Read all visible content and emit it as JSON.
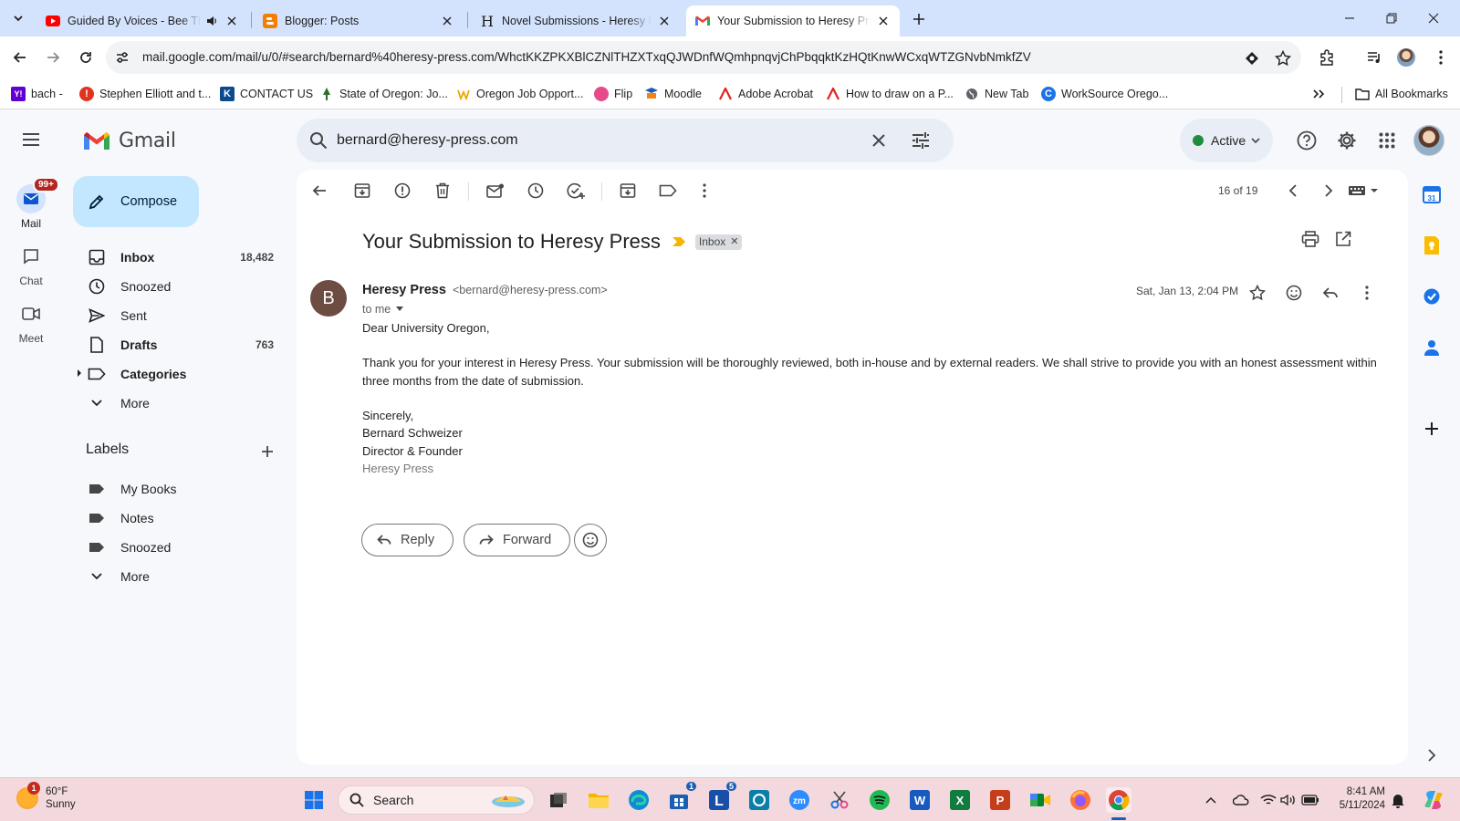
{
  "browser": {
    "tabs": [
      {
        "title": "Guided By Voices - Bee Thousand",
        "favicon": "youtube-icon"
      },
      {
        "title": "Blogger: Posts",
        "favicon": "blogger-icon"
      },
      {
        "title": "Novel Submissions - Heresy Press",
        "favicon": "h-icon"
      },
      {
        "title": "Your Submission to Heresy Press",
        "favicon": "gmail-icon"
      }
    ],
    "url": "mail.google.com/mail/u/0/#search/bernard%40heresy-press.com/WhctKKZPKXBlCZNlTHZXTxqQJWDnfWQmhpnqvjChPbqqktKzHQtKnwWCxqWTZGNvbNmkfZV",
    "bookmarks": [
      {
        "label": "bach -",
        "icon": "Y!",
        "color": "#6001d2"
      },
      {
        "label": "Stephen Elliott and t...",
        "icon": "!",
        "color": "#e0341e"
      },
      {
        "label": "CONTACT US",
        "icon": "K",
        "color": "#0b4a8c"
      },
      {
        "label": "State of Oregon: Jo...",
        "icon": "",
        "color": "#2f6d2a"
      },
      {
        "label": "Oregon Job Opport...",
        "icon": "",
        "color": "#f0a500"
      },
      {
        "label": "Flip",
        "icon": "",
        "color": "#e64a8b"
      },
      {
        "label": "Moodle",
        "icon": "",
        "color": "#1a5bb6"
      },
      {
        "label": "Adobe Acrobat",
        "icon": "",
        "color": "#e0241e"
      },
      {
        "label": "How to draw on a P...",
        "icon": "",
        "color": "#e0241e"
      },
      {
        "label": "New Tab",
        "icon": "",
        "color": "#5f6368"
      },
      {
        "label": "WorkSource Orego...",
        "icon": "C",
        "color": "#1a73e8"
      }
    ],
    "all_bookmarks": "All Bookmarks"
  },
  "gmail": {
    "product_name": "Gmail",
    "search_value": "bernard@heresy-press.com",
    "status": "Active",
    "rail": [
      {
        "label": "Mail",
        "badge": "99+"
      },
      {
        "label": "Chat"
      },
      {
        "label": "Meet"
      }
    ],
    "compose": "Compose",
    "nav": [
      {
        "label": "Inbox",
        "count": "18,482"
      },
      {
        "label": "Snoozed",
        "count": ""
      },
      {
        "label": "Sent",
        "count": ""
      },
      {
        "label": "Drafts",
        "count": "763"
      },
      {
        "label": "Categories",
        "count": ""
      },
      {
        "label": "More",
        "count": ""
      }
    ],
    "labels_heading": "Labels",
    "labels": [
      {
        "label": "My Books"
      },
      {
        "label": "Notes"
      },
      {
        "label": "Snoozed"
      },
      {
        "label": "More"
      }
    ]
  },
  "message": {
    "pager": "16 of 19",
    "subject": "Your Submission to Heresy Press",
    "label_chip": "Inbox",
    "sender_initial": "B",
    "sender_name": "Heresy Press",
    "sender_email": "<bernard@heresy-press.com>",
    "to": "to me",
    "date": "Sat, Jan 13, 2:04 PM",
    "greeting": "Dear University Oregon,",
    "paragraph": "Thank you for your interest in Heresy Press. Your submission will be thoroughly reviewed, both in-house and by external readers. We shall strive to provide you with an honest assessment within three months from the date of submission.",
    "signature": [
      "Sincerely,",
      "Bernard Schweizer",
      "Director & Founder",
      "Heresy Press"
    ],
    "reply_label": "Reply",
    "forward_label": "Forward"
  },
  "taskbar": {
    "weather_temp": "60°F",
    "weather_cond": "Sunny",
    "weather_badge": "1",
    "search_label": "Search",
    "time": "8:41 AM",
    "date": "5/11/2024",
    "badges": {
      "store": "1",
      "l_app": "5"
    }
  },
  "colors": {
    "accent": "#0b57d0",
    "compose_bg": "#c2e7ff",
    "tab_strip": "#d3e3fd",
    "taskbar": "#f3d9dd"
  }
}
